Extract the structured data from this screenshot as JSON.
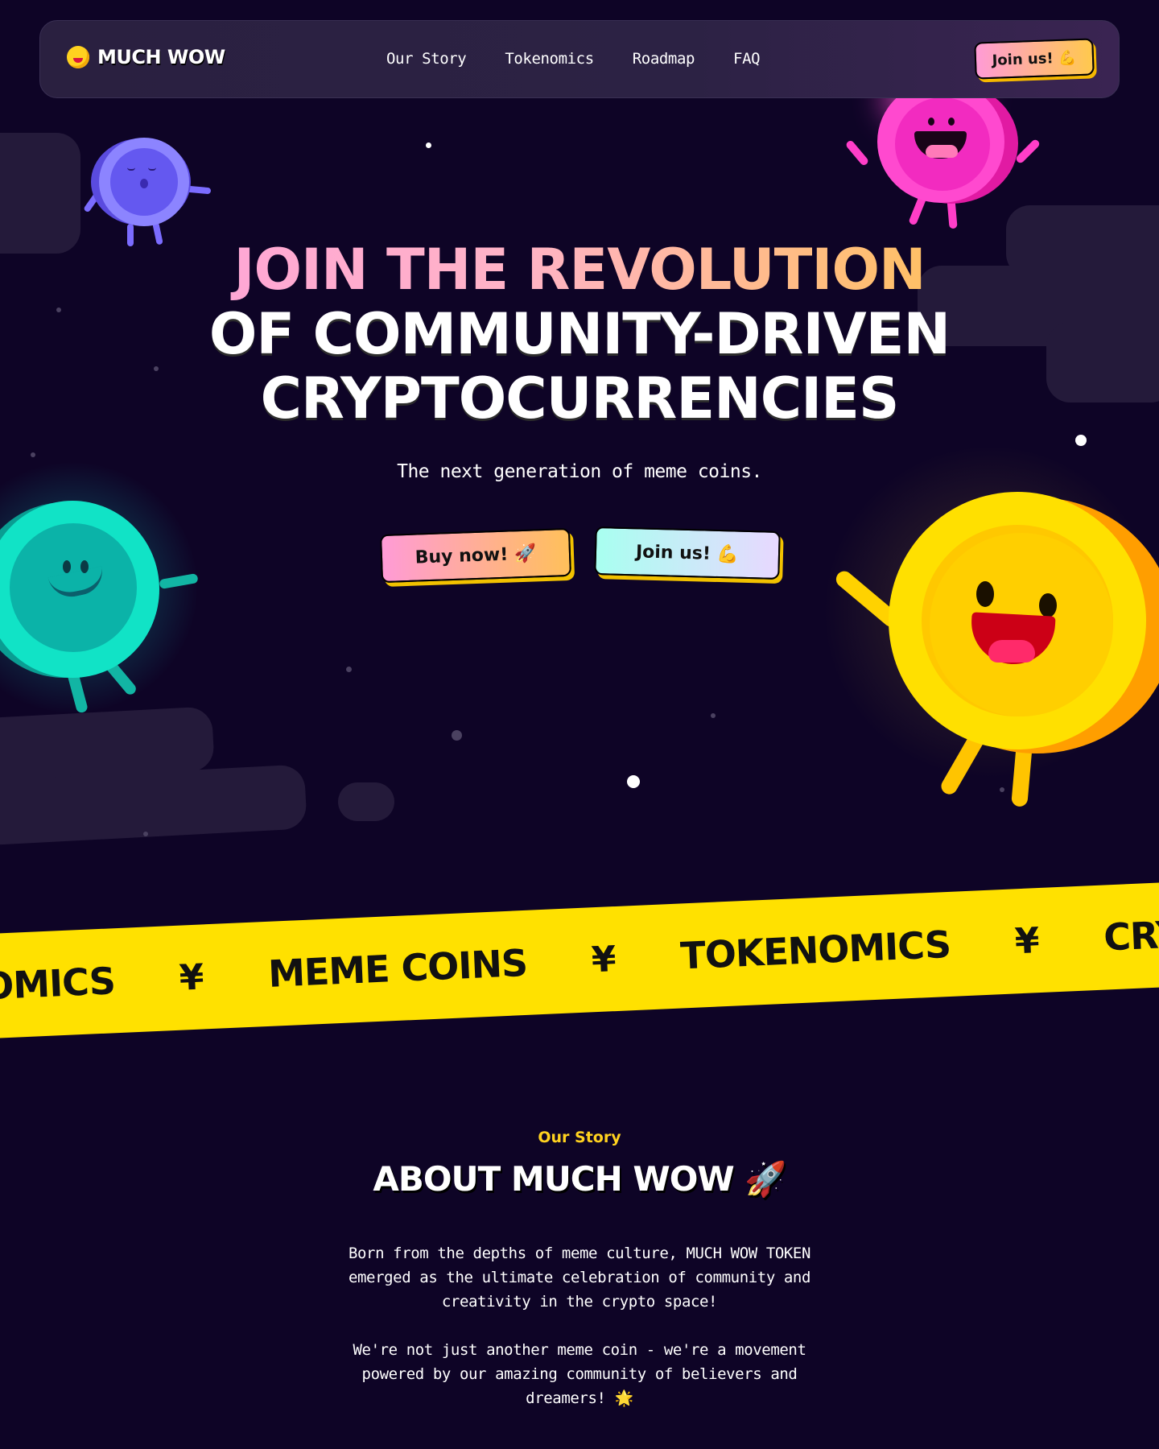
{
  "brand": {
    "name": "MUCH WOW"
  },
  "nav": {
    "links": [
      "Our Story",
      "Tokenomics",
      "Roadmap",
      "FAQ"
    ],
    "cta_label": "Join us! 💪"
  },
  "hero": {
    "title_line1": "JOIN THE REVOLUTION",
    "title_line2": "OF COMMUNITY-DRIVEN",
    "title_line3": "CRYPTOCURRENCIES",
    "subtitle": "The next generation of meme coins.",
    "buy_label": "Buy now! 🚀",
    "join_label": "Join us! 💪"
  },
  "ticker": {
    "items": [
      "NOMICS",
      "MEME COINS",
      "TOKENOMICS",
      "CRYPTO"
    ],
    "separator": "¥"
  },
  "story": {
    "eyebrow": "Our Story",
    "title": "ABOUT MUCH WOW 🚀",
    "paragraph1": "Born from the depths of meme culture, MUCH WOW TOKEN emerged as the ultimate celebration of community and creativity in the crypto space!",
    "paragraph2": "We're not just another meme coin - we're a movement powered by our amazing community of believers and dreamers! 🌟"
  },
  "colors": {
    "background": "#0e0426",
    "accent_yellow": "#ffe100",
    "accent_pink": "#ff9bd6",
    "accent_teal": "#a8fff0"
  },
  "icons": [
    "coin-logo-icon",
    "rocket-icon",
    "flexed-biceps-icon",
    "yen-icon",
    "glowing-star-icon"
  ]
}
